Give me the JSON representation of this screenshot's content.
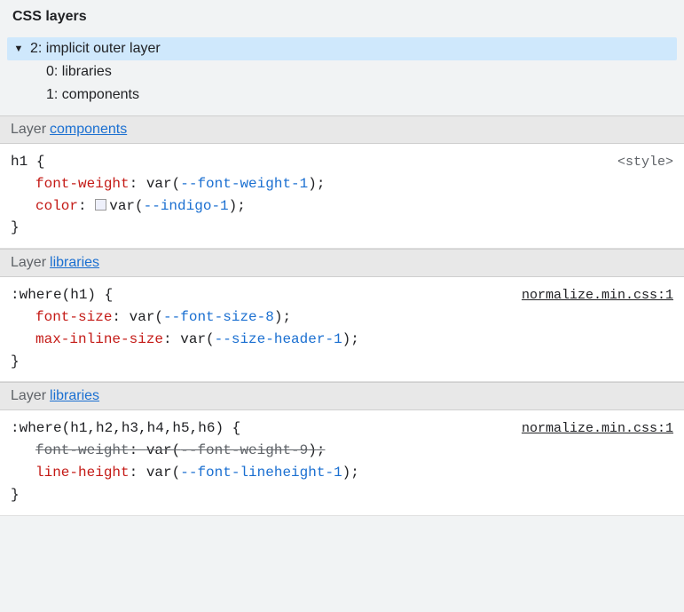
{
  "title": "CSS layers",
  "tree": {
    "root": {
      "index": "2",
      "label": "implicit outer layer",
      "expanded": true,
      "selected": true
    },
    "children": [
      {
        "index": "0",
        "label": "libraries"
      },
      {
        "index": "1",
        "label": "components"
      }
    ]
  },
  "layer_label_prefix": "Layer",
  "rules": [
    {
      "layer_name": "components",
      "selector": "h1",
      "open_brace": "{",
      "close_brace": "}",
      "source": {
        "kind": "tag",
        "text": "<style>"
      },
      "declarations": [
        {
          "property": "font-weight",
          "value_prefix": "var(",
          "var_name": "--font-weight-1",
          "value_suffix": ")",
          "overridden": false,
          "swatch": false
        },
        {
          "property": "color",
          "value_prefix": "var(",
          "var_name": "--indigo-1",
          "value_suffix": ")",
          "overridden": false,
          "swatch": true
        }
      ]
    },
    {
      "layer_name": "libraries",
      "selector": ":where(h1)",
      "open_brace": "{",
      "close_brace": "}",
      "source": {
        "kind": "link",
        "text": "normalize.min.css:1"
      },
      "declarations": [
        {
          "property": "font-size",
          "value_prefix": "var(",
          "var_name": "--font-size-8",
          "value_suffix": ")",
          "overridden": false,
          "swatch": false
        },
        {
          "property": "max-inline-size",
          "value_prefix": "var(",
          "var_name": "--size-header-1",
          "value_suffix": ")",
          "overridden": false,
          "swatch": false
        }
      ]
    },
    {
      "layer_name": "libraries",
      "selector": ":where(h1,h2,h3,h4,h5,h6)",
      "open_brace": "{",
      "close_brace": "}",
      "source": {
        "kind": "link",
        "text": "normalize.min.css:1"
      },
      "declarations": [
        {
          "property": "font-weight",
          "value_prefix": "var(",
          "var_name": "--font-weight-9",
          "value_suffix": ")",
          "overridden": true,
          "swatch": false
        },
        {
          "property": "line-height",
          "value_prefix": "var(",
          "var_name": "--font-lineheight-1",
          "value_suffix": ")",
          "overridden": false,
          "swatch": false
        }
      ]
    }
  ]
}
